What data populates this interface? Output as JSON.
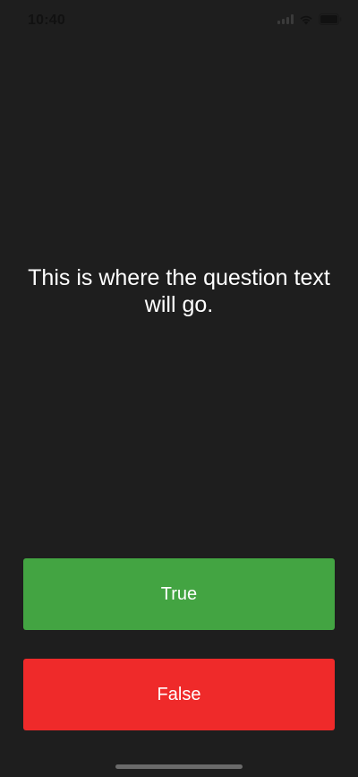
{
  "status_bar": {
    "time": "10:40",
    "icons": [
      "cellular-signal-icon",
      "wifi-icon",
      "battery-icon"
    ]
  },
  "quiz": {
    "question_text": "This is where the question text will go.",
    "true_label": "True",
    "false_label": "False"
  },
  "colors": {
    "background": "#1e1e1e",
    "true_button": "#43a442",
    "false_button": "#ef2a2a",
    "text": "#ffffff"
  }
}
